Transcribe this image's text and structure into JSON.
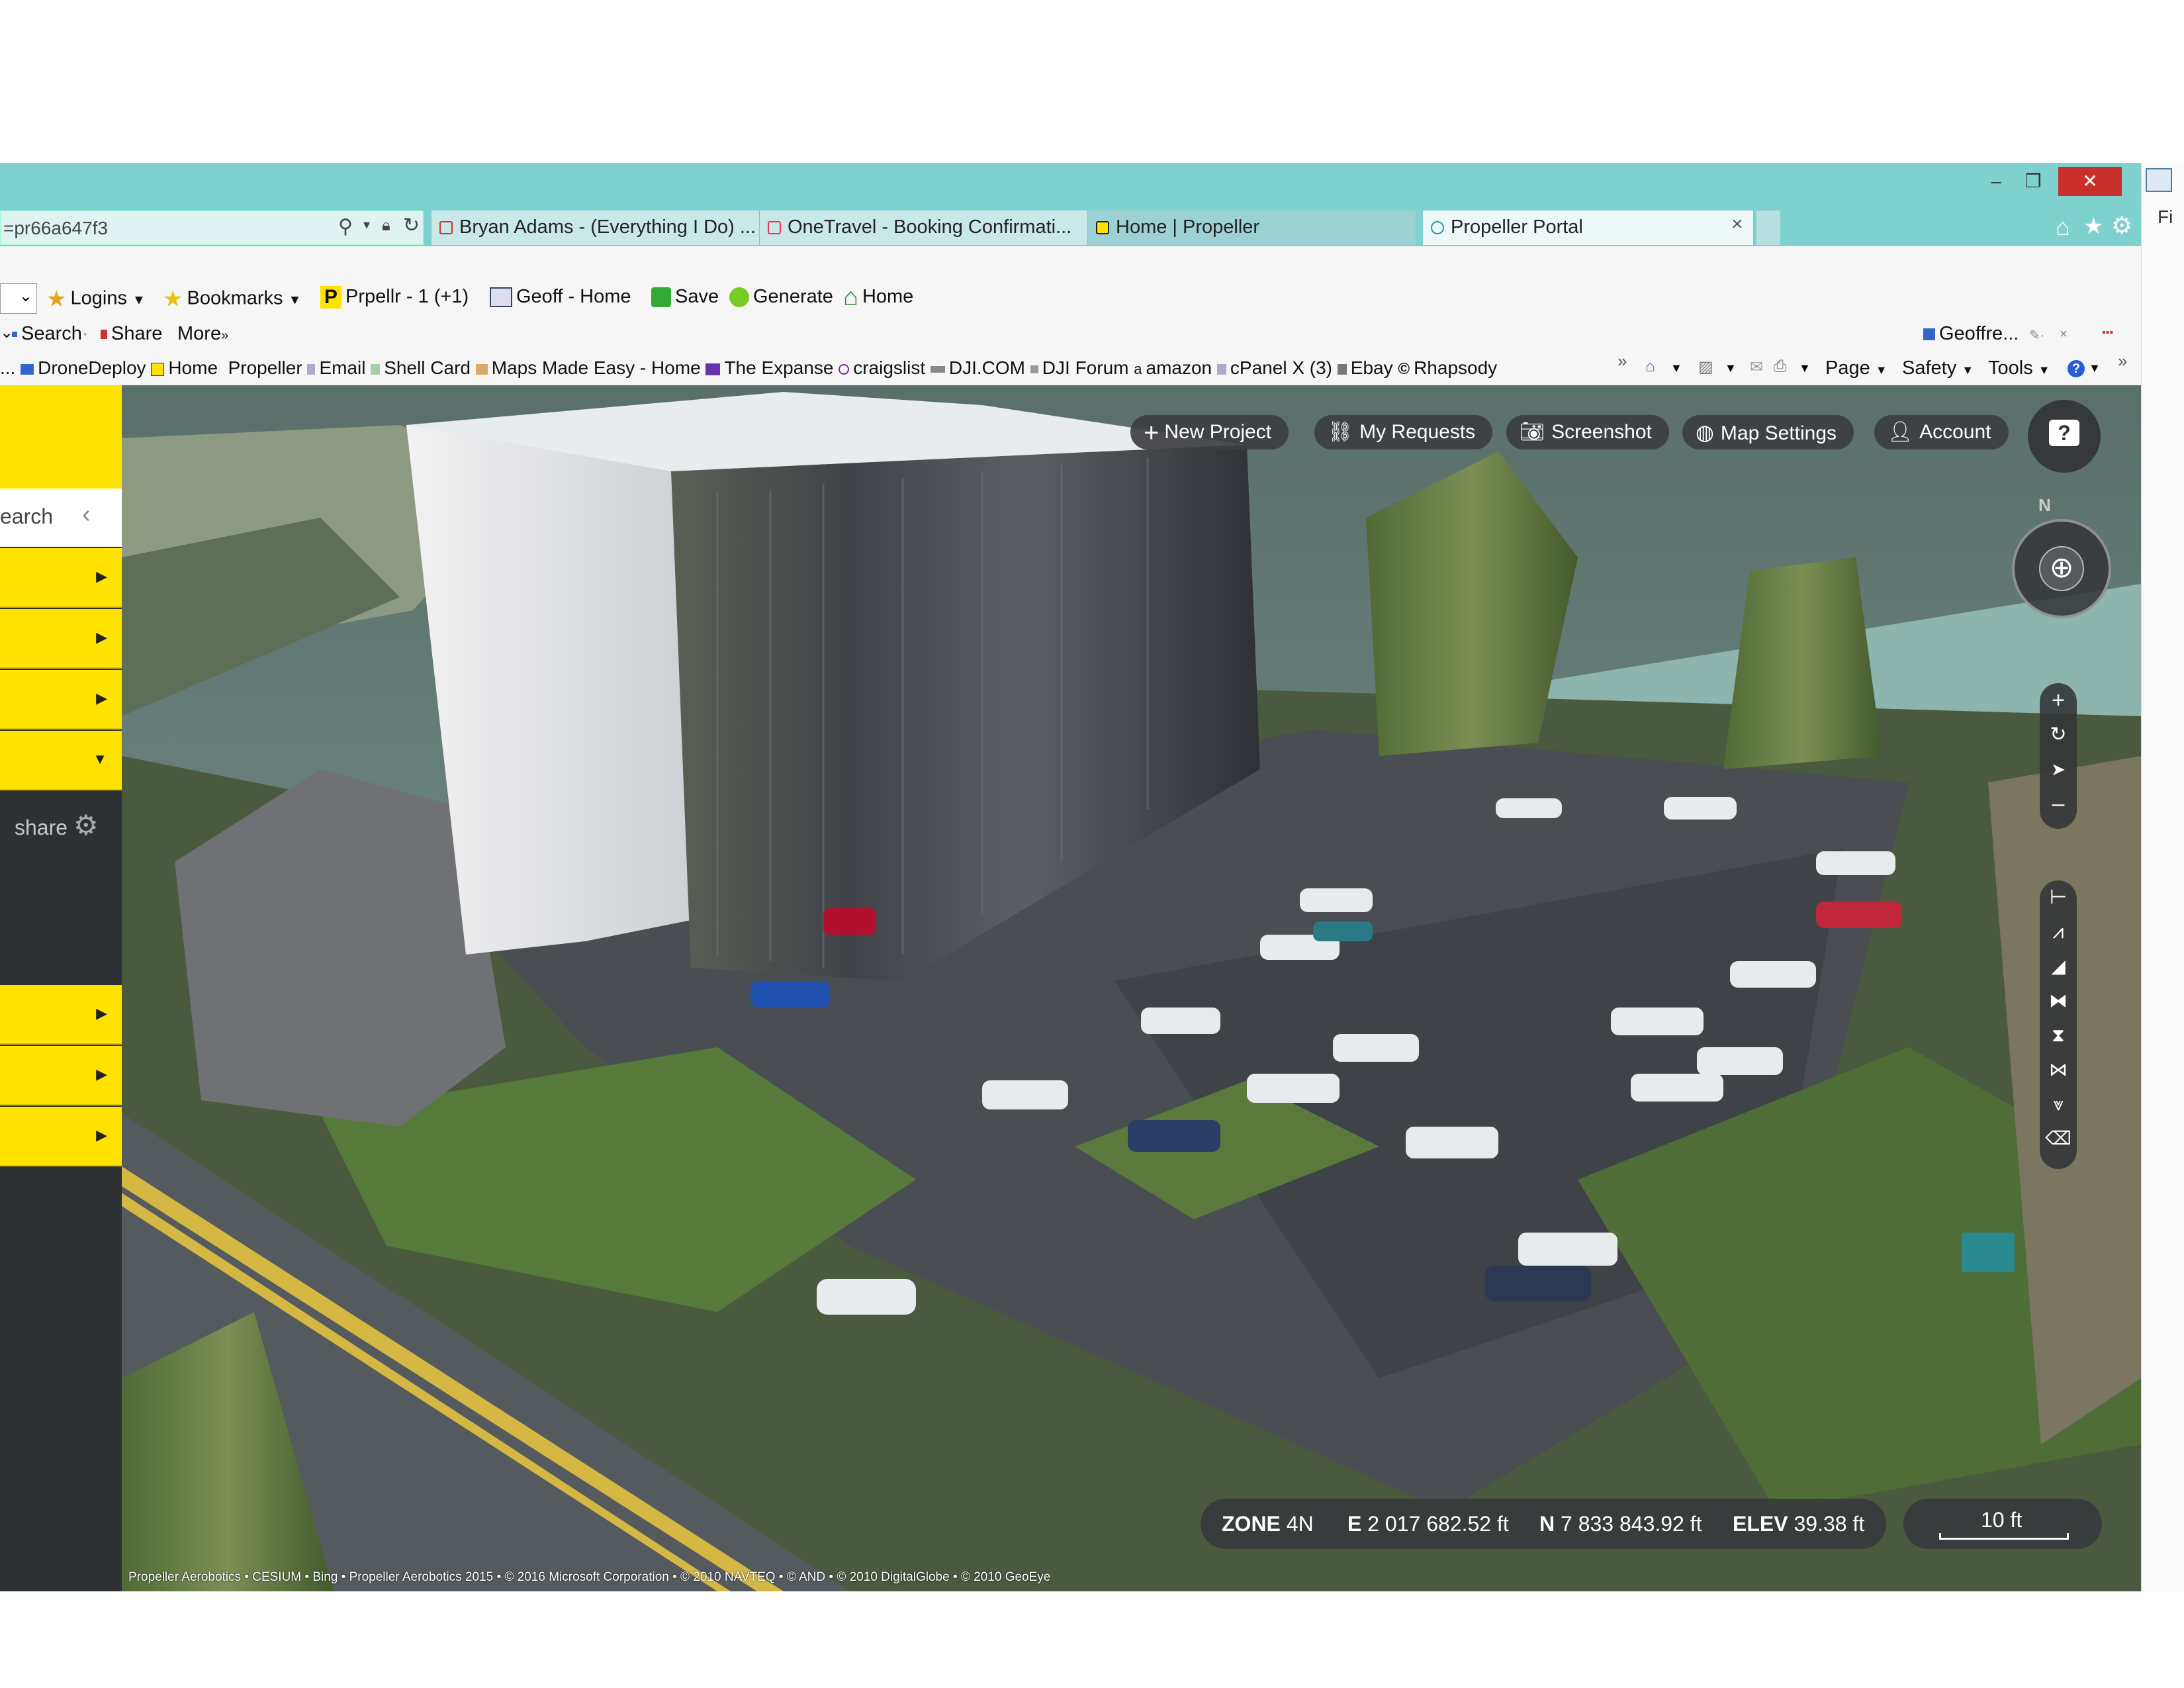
{
  "window": {
    "minimize": "–",
    "restore": "❐",
    "close": "✕"
  },
  "address": {
    "text": "=pr66a647f3"
  },
  "tabs": [
    {
      "label": "Bryan Adams - (Everything I Do) ..."
    },
    {
      "label": "OneTravel - Booking Confirmati..."
    },
    {
      "label": "Home | Propeller"
    },
    {
      "label": "Propeller Portal"
    }
  ],
  "tab_close": "×",
  "toolbar1": {
    "logins": "Logins",
    "bookmarks": "Bookmarks",
    "prpellr": "Prpellr - 1 (+1)",
    "geoff_home": "Geoff - Home",
    "save": "Save",
    "generate": "Generate",
    "home": "Home"
  },
  "toolbar2": {
    "search": "Search",
    "share": "Share",
    "more": "More",
    "more_glyph": "»",
    "user": "Geoffre..."
  },
  "favorites": [
    "DroneDeploy",
    "Home",
    "Propeller",
    "Email",
    "Shell Card",
    "Maps Made Easy - Home",
    "The Expanse",
    "craigslist",
    "DJI.COM",
    "DJI Forum",
    "amazon",
    "cPanel X (3)",
    "Ebay",
    "Rhapsody"
  ],
  "favorites_lead": "...",
  "cmd": {
    "page": "Page",
    "safety": "Safety",
    "tools": "Tools",
    "help": "?"
  },
  "sidebar": {
    "search": "earch",
    "share": "share"
  },
  "map_buttons": {
    "new_project": "New Project",
    "my_requests": "My Requests",
    "screenshot": "Screenshot",
    "map_settings": "Map Settings",
    "account": "Account",
    "help": "?"
  },
  "compass": {
    "north": "N"
  },
  "zoom": {
    "in": "+",
    "out": "–"
  },
  "coords": {
    "zone_label": "ZONE",
    "zone": "4N",
    "e_label": "E",
    "e": "2 017 682.52 ft",
    "n_label": "N",
    "n": "7 833 843.92 ft",
    "elev_label": "ELEV",
    "elev": "39.38 ft"
  },
  "scale": {
    "label": "10 ft"
  },
  "attribution": "Propeller Aerobotics • CESIUM • Bing • Propeller Aerobotics 2015 • © 2016 Microsoft Corporation • © 2010 NAVTEQ • © AND • © 2010 DigitalGlobe • © 2010 GeoEye",
  "right_edge": "Fi",
  "colors": {
    "titlebar": "#7fd1cf",
    "sidebar_yellow": "#ffe200",
    "sidebar_dark": "#2e3134",
    "close": "#c9302c"
  }
}
